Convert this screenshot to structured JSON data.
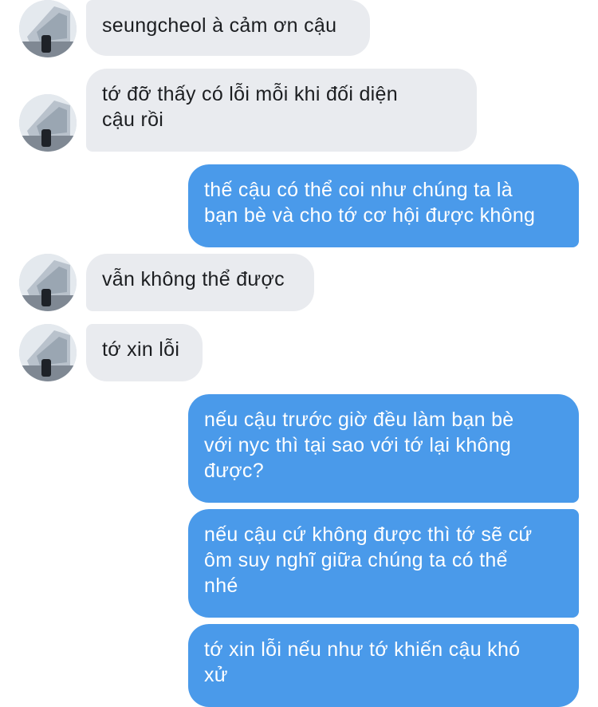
{
  "conversation": {
    "messages": [
      {
        "from": "other",
        "text": "seungcheol à cảm ơn cậu"
      },
      {
        "from": "other",
        "text": "tớ đỡ thấy có lỗi mỗi khi đối diện\ncậu rồi"
      },
      {
        "from": "me",
        "text": "thế cậu có thể coi như chúng ta là\nbạn bè và cho tớ cơ hội được không"
      },
      {
        "from": "other",
        "text": "vẫn không thể được"
      },
      {
        "from": "other",
        "text": "tớ xin lỗi"
      },
      {
        "from": "me",
        "text": "nếu cậu trước giờ đều làm bạn bè\nvới nyc thì tại sao với tớ lại không\nđược?"
      },
      {
        "from": "me",
        "text": "nếu cậu cứ không được thì tớ sẽ cứ\nôm suy nghĩ giữa chúng ta có thể\nnhé"
      },
      {
        "from": "me",
        "text": "tớ xin lỗi nếu như tớ khiến cậu khó\nxử"
      }
    ]
  },
  "colors": {
    "incoming_bubble": "#e9ebef",
    "outgoing_bubble": "#4a9aea",
    "incoming_text": "#1c1e21",
    "outgoing_text": "#ffffff"
  }
}
